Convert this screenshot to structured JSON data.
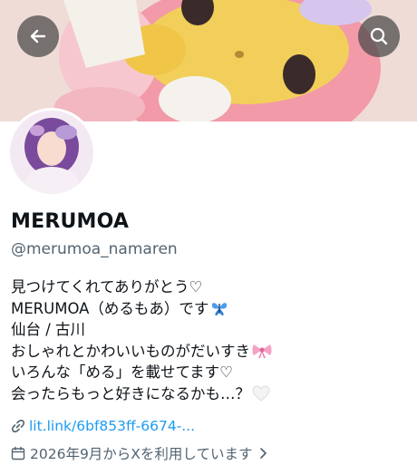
{
  "header": {
    "back_icon": "arrow-left-icon",
    "search_icon": "search-icon"
  },
  "profile": {
    "display_name": "MERUMOA",
    "handle": "@merumoa_namaren",
    "bio_lines": [
      "見つけてくれてありがとう♡",
      "MERUMOA（めるもあ）です",
      "仙台 / 古川",
      "おしゃれとかわいいものがだいすき",
      "いろんな「める」を載せてます♡",
      "会ったらもっと好きになるかも…？"
    ],
    "link": "lit.link/6bf853ff-6674-...",
    "joined": "2026年9月からXを利用しています"
  },
  "colors": {
    "accent": "#1d9bf0",
    "secondary_text": "#536471",
    "primary_text": "#0f1419"
  }
}
